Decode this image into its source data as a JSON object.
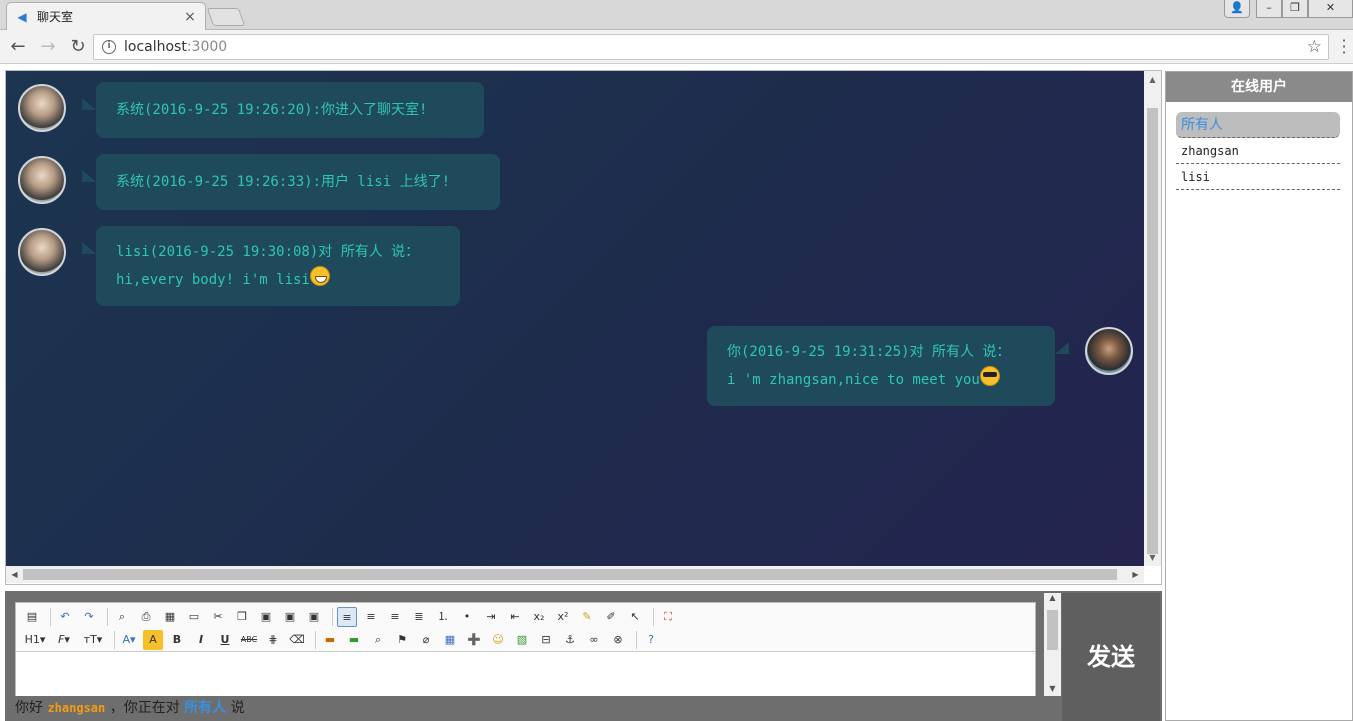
{
  "browser": {
    "tab_title": "聊天室",
    "tab_close": "×",
    "url_host": "localhost",
    "url_port": ":3000"
  },
  "messages": [
    {
      "side": "left",
      "line1": "系统(2016-9-25 19:26:20):你进入了聊天室!",
      "line2": ""
    },
    {
      "side": "left",
      "line1": "系统(2016-9-25 19:26:33):用户 lisi 上线了!",
      "line2": ""
    },
    {
      "side": "left",
      "line1": "lisi(2016-9-25 19:30:08)对 所有人 说：",
      "line2": "hi,every body! i'm lisi",
      "emoji": "grin"
    },
    {
      "side": "right",
      "line1": "你(2016-9-25 19:31:25)对 所有人 说：",
      "line2": "i 'm zhangsan,nice to meet you",
      "emoji": "cool"
    }
  ],
  "users_panel": {
    "title": "在线用户",
    "items": [
      "所有人",
      "zhangsan",
      "lisi"
    ],
    "selected_index": 0
  },
  "editor": {
    "send_label": "发送",
    "toolbar_row1": [
      "source-icon",
      "undo-icon",
      "redo-icon",
      "preview-icon",
      "print-icon",
      "template-icon",
      "code-icon",
      "cut-icon",
      "copy-icon",
      "paste-icon",
      "paste-text-icon",
      "paste-word-icon",
      "align-left-icon",
      "align-center-icon",
      "align-right-icon",
      "justify-icon",
      "ordered-list-icon",
      "unordered-list-icon",
      "indent-icon",
      "outdent-icon",
      "subscript-icon",
      "superscript-icon",
      "clear-format-icon",
      "select-all-icon",
      "cursor-icon",
      "fullscreen-icon"
    ],
    "toolbar_row2_labels": {
      "heading": "H1",
      "font": "F",
      "size": "тT",
      "bold": "B",
      "italic": "I",
      "underline": "U",
      "strike": "ABC"
    }
  },
  "status": {
    "prefix": "你好",
    "username": "zhangsan",
    "middle": "，你正在对",
    "target": "所有人",
    "suffix": "说"
  },
  "colors": {
    "bubble_bg": "#1f4a5c",
    "bubble_text": "#2fc6b0",
    "chat_bg_start": "#1c3550",
    "chat_bg_end": "#24244f",
    "selected_user": "#3a8fe0",
    "username_highlight": "#f39c12"
  }
}
